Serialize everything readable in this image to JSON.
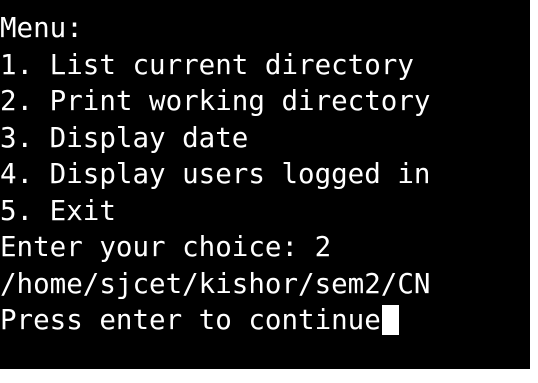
{
  "terminal": {
    "background": "#000000",
    "foreground": "#ffffff",
    "lines": [
      "Menu:",
      "1. List current directory",
      "2. Print working directory",
      "3. Display date",
      "4. Display users logged in",
      "5. Exit",
      "Enter your choice: 2",
      "/home/sjcet/kishor/sem2/CN",
      "Press enter to continue"
    ]
  }
}
